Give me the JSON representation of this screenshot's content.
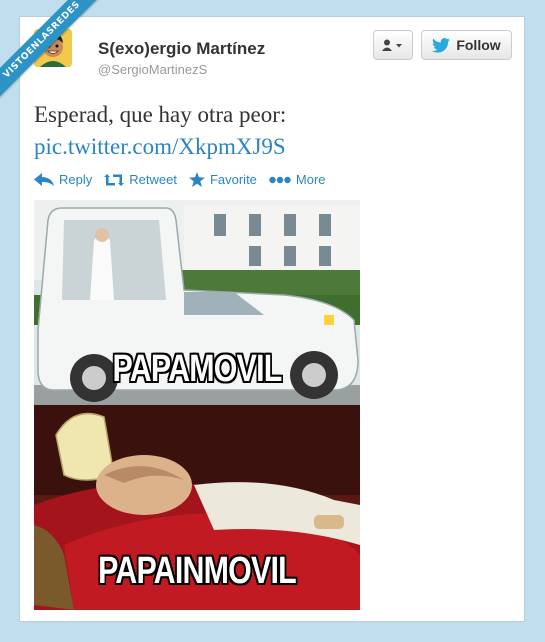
{
  "watermark": "VISTOENLASREDES",
  "user": {
    "display_name": "S(exo)ergio Martínez",
    "screen_name": "@SergioMartinezS",
    "avatar_icon": "avatar-illustration"
  },
  "buttons": {
    "user_menu_icon": "user-dropdown-icon",
    "follow_label": "Follow"
  },
  "tweet": {
    "text": "Esperad, que hay otra peor:",
    "link": "pic.twitter.com/XkpmXJ9S"
  },
  "actions": [
    {
      "label": "Reply",
      "icon": "reply-icon"
    },
    {
      "label": "Retweet",
      "icon": "retweet-icon"
    },
    {
      "label": "Favorite",
      "icon": "star-icon"
    },
    {
      "label": "More",
      "icon": "more-icon"
    }
  ],
  "media": {
    "top_caption": "PAPAMOVIL",
    "bottom_caption": "PAPAINMOVIL"
  },
  "colors": {
    "background": "#c0deed",
    "link": "#2a85c6",
    "ribbon": "#2b93c6"
  }
}
